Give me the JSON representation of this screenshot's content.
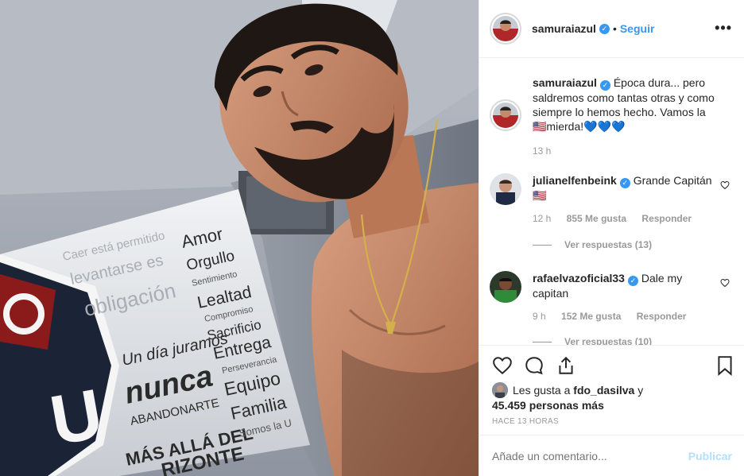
{
  "header": {
    "username": "samuraiazul",
    "separator": "•",
    "follow_label": "Seguir",
    "more_label": "•••"
  },
  "caption": {
    "username": "samuraiazul",
    "text": "Época dura... pero saldremos como tantas otras y como siempre lo hemos hecho. Vamos la 🇺🇸mierda!💙💙💙",
    "time": "13 h"
  },
  "comments": [
    {
      "username": "julianelfenbeink",
      "text": "Grande Capitán 🇺🇸",
      "time": "12 h",
      "likes": "855 Me gusta",
      "reply_label": "Responder",
      "view_replies": "Ver respuestas (13)"
    },
    {
      "username": "rafaelvazoficial33",
      "text": "Dale my capitan",
      "time": "9 h",
      "likes": "152 Me gusta",
      "reply_label": "Responder",
      "view_replies": "Ver respuestas (10)"
    }
  ],
  "likes": {
    "prefix": "Les gusta a",
    "user": "fdo_dasilva",
    "middle": "y",
    "count": "45.459 personas más"
  },
  "posted_time": "HACE 13 HORAS",
  "add_comment": {
    "placeholder": "Añade un comentario...",
    "publish_label": "Publicar"
  },
  "photo": {
    "wall_text": {
      "line1": "Caer está permitido",
      "line2": "levantarse es",
      "line3": "obligación",
      "amor": "Amor",
      "orgullo": "Orgullo",
      "sentimiento": "Sentimiento",
      "lealtad": "Lealtad",
      "compromiso": "Compromiso",
      "sacrificio": "Sacrificio",
      "un_dia": "Un día juramos",
      "nunca": "nunca",
      "abandonarte": "ABANDONARTE",
      "entrega": "Entrega",
      "perseverancia": "Perseverancia",
      "equipo": "Equipo",
      "familia": "Familia",
      "mas_alla": "MÁS ALLÁ DEL",
      "horizonte": "RIZONTE",
      "somos": "Somos la U",
      "crest_letter": "U"
    }
  },
  "colors": {
    "accent": "#3897f0",
    "publish_disabled": "#b2dffc",
    "crest_red": "#8b1a1a",
    "crest_navy": "#1b2437"
  }
}
